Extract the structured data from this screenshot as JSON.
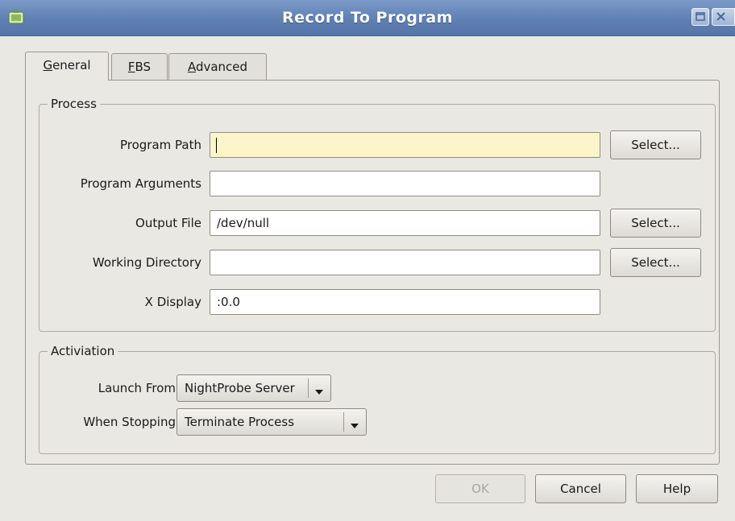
{
  "window": {
    "title": "Record To Program",
    "icon": "app-window-icon",
    "controls": [
      "maximize-icon",
      "close-icon"
    ]
  },
  "tabs": [
    {
      "label_underline": "G",
      "label_rest": "eneral",
      "active": true
    },
    {
      "label_underline": "F",
      "label_rest": "BS",
      "active": false
    },
    {
      "label_underline": "A",
      "label_rest": "dvanced",
      "active": false
    }
  ],
  "process": {
    "title": "Process",
    "program_path": {
      "label": "Program Path",
      "value": ""
    },
    "program_arguments": {
      "label": "Program Arguments",
      "value": ""
    },
    "output_file": {
      "label": "Output File",
      "value": "/dev/null"
    },
    "working_directory": {
      "label": "Working Directory",
      "value": ""
    },
    "x_display": {
      "label": "X Display",
      "value": ":0.0"
    },
    "select_label": "Select..."
  },
  "activiation": {
    "title": "Activiation",
    "launch_from": {
      "label": "Launch From",
      "value": "NightProbe Server"
    },
    "when_stopping": {
      "label": "When Stopping",
      "value": "Terminate Process"
    }
  },
  "buttons": {
    "ok": "OK",
    "cancel": "Cancel",
    "help": "Help"
  },
  "colors": {
    "titlebar": "#5f80b3",
    "focused_input": "#fbf5c9",
    "background": "#eae8e3"
  }
}
